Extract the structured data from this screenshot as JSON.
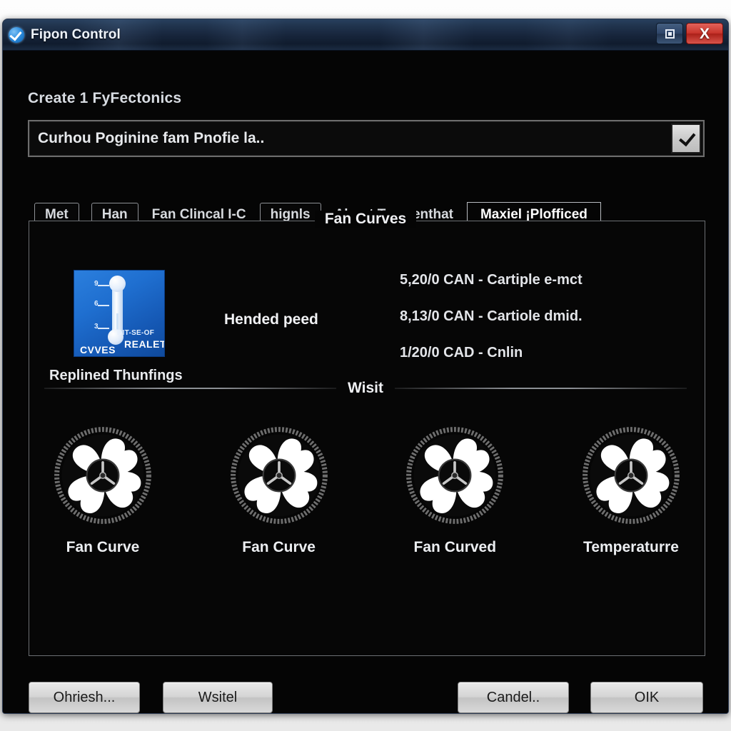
{
  "window": {
    "title": "Fipon Control",
    "app_icon": "shield-check-icon",
    "buttons": {
      "maximize": "maximize-icon",
      "close": "X"
    }
  },
  "form": {
    "create_label": "Create 1 FyFectonics",
    "combo_value": "Curhou Poginine fam Pnofie la..",
    "combo_button_icon": "checkmark-icon"
  },
  "tabs": [
    {
      "label": "Met",
      "style": "boxed"
    },
    {
      "label": "Han",
      "style": "boxed"
    },
    {
      "label": "Fan Clincal I-C",
      "style": "plain"
    },
    {
      "label": "hignls",
      "style": "boxed"
    },
    {
      "label": "About Tempenthat",
      "style": "plain"
    },
    {
      "label": "Maxiel ¡Plofficed",
      "style": "selected"
    }
  ],
  "group": {
    "legend": "Fan Curves",
    "divider_label": "Wisit"
  },
  "thermo": {
    "caption": "Replined Thunfings",
    "icon_text_a": "DIT-SE-OF",
    "icon_text_b": "REALET",
    "icon_text_c": "CVVES",
    "scale_labels": [
      "9",
      "6",
      "3"
    ]
  },
  "hended_label": "Hended peed",
  "info_lines": [
    "5,20/0 CAN - Cartiple e-mct",
    "8,13/0 CAN - Cartiole dmid.",
    "1/20/0 CAD - Cnlin"
  ],
  "fans": [
    {
      "caption": "Fan Curve"
    },
    {
      "caption": "Fan Curve"
    },
    {
      "caption": "Fan Curved"
    },
    {
      "caption": "Temperaturre"
    }
  ],
  "footer": {
    "refresh": "Ohriesh...",
    "wsitel": "Wsitel",
    "cancel": "Candel..",
    "ok": "OIK"
  },
  "colors": {
    "titlebar": "#16243a",
    "close_red": "#c9352c",
    "icon_blue": "#1f6fd0",
    "client_bg": "#050505"
  }
}
